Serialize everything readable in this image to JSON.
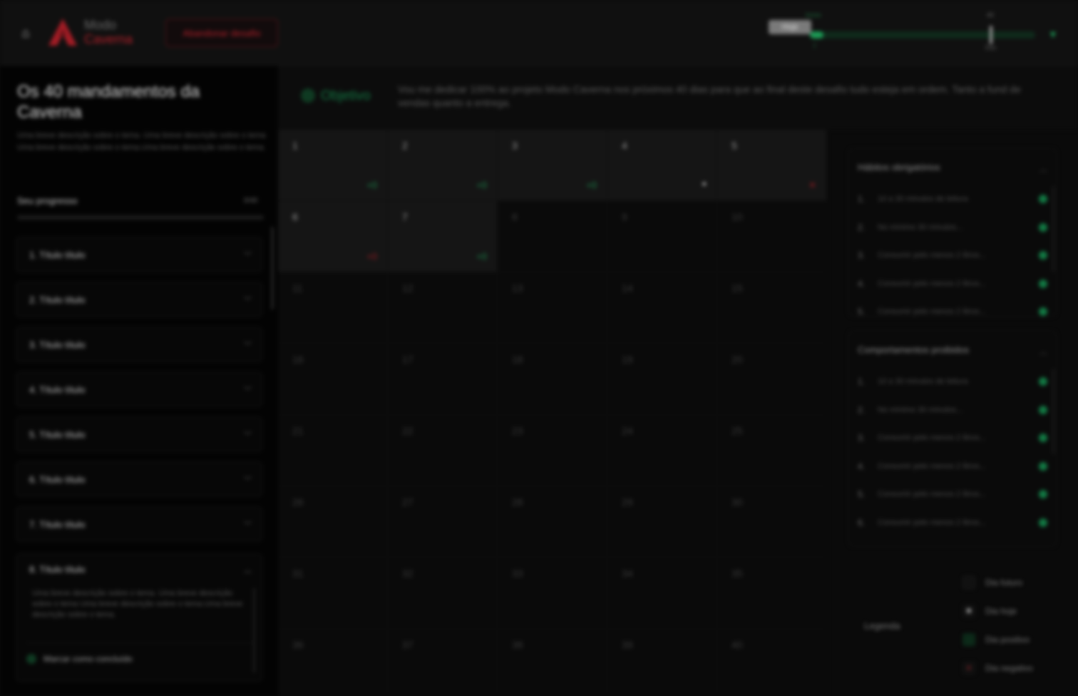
{
  "header": {
    "home_icon": "home-icon",
    "logo_line1": "Modo",
    "logo_line2": "Caverna",
    "abandon_label": "Abandonar desafio",
    "progress": {
      "day_tag": "Hoje",
      "label_top": "Início",
      "label_bottom": "7",
      "label_marker_top": "40",
      "label_marker_bottom": "Fim",
      "fill_fraction": 0.06,
      "marker_fraction": 0.8
    },
    "colors": {
      "accent_red": "#b3202a",
      "accent_green": "#1c9a55"
    }
  },
  "sidebar": {
    "title": "Os 40 mandamentos da Caverna",
    "description": "Uma breve descrição sobre o tema. Uma breve descrição sobre o tema Uma breve descrição sobre o tema.Uma breve descrição sobre o tema.",
    "progress_label": "Seu progresso",
    "progress_value": "0/40",
    "items": [
      {
        "label": "1. Título título"
      },
      {
        "label": "2. Título título"
      },
      {
        "label": "3. Título título"
      },
      {
        "label": "4. Título título"
      },
      {
        "label": "5. Título título"
      },
      {
        "label": "6. Título título"
      },
      {
        "label": "7. Título título"
      }
    ],
    "open_item": {
      "label": "8. Título título",
      "body": "Uma breve descrição sobre o tema. Uma breve descrição sobre o tema Uma breve descrição sobre o tema.Uma breve descrição sobre o tema.",
      "mark_label": "Marcar como concluído"
    }
  },
  "objective": {
    "label": "Objetivo",
    "text": "Vou me dedicar 100% ao projeto Modo Caverna nos próximos 40 dias para que ao final deste desafio tudo esteja em ordem. Tanto a fund de vendas quanto a entrega."
  },
  "calendar": {
    "days": [
      {
        "n": "1",
        "state": "pos",
        "mark": "+0"
      },
      {
        "n": "2",
        "state": "pos",
        "mark": "+0"
      },
      {
        "n": "3",
        "state": "pos",
        "mark": "+0"
      },
      {
        "n": "4",
        "state": "today",
        "mark": "●"
      },
      {
        "n": "5",
        "state": "neg",
        "mark": "✕"
      },
      {
        "n": "6",
        "state": "neg",
        "mark": "+0"
      },
      {
        "n": "7",
        "state": "pos",
        "mark": "+0"
      },
      {
        "n": "8",
        "state": "future",
        "mark": ""
      },
      {
        "n": "9",
        "state": "future",
        "mark": ""
      },
      {
        "n": "10",
        "state": "future",
        "mark": ""
      },
      {
        "n": "11",
        "state": "future",
        "mark": ""
      },
      {
        "n": "12",
        "state": "future",
        "mark": ""
      },
      {
        "n": "13",
        "state": "future",
        "mark": ""
      },
      {
        "n": "14",
        "state": "future",
        "mark": ""
      },
      {
        "n": "15",
        "state": "future",
        "mark": ""
      },
      {
        "n": "16",
        "state": "future",
        "mark": ""
      },
      {
        "n": "17",
        "state": "future",
        "mark": ""
      },
      {
        "n": "18",
        "state": "future",
        "mark": ""
      },
      {
        "n": "19",
        "state": "future",
        "mark": ""
      },
      {
        "n": "20",
        "state": "future",
        "mark": ""
      },
      {
        "n": "21",
        "state": "future",
        "mark": ""
      },
      {
        "n": "22",
        "state": "future",
        "mark": ""
      },
      {
        "n": "23",
        "state": "future",
        "mark": ""
      },
      {
        "n": "24",
        "state": "future",
        "mark": ""
      },
      {
        "n": "25",
        "state": "future",
        "mark": ""
      },
      {
        "n": "26",
        "state": "future",
        "mark": ""
      },
      {
        "n": "27",
        "state": "future",
        "mark": ""
      },
      {
        "n": "28",
        "state": "future",
        "mark": ""
      },
      {
        "n": "29",
        "state": "future",
        "mark": ""
      },
      {
        "n": "30",
        "state": "future",
        "mark": ""
      },
      {
        "n": "31",
        "state": "future",
        "mark": ""
      },
      {
        "n": "32",
        "state": "future",
        "mark": ""
      },
      {
        "n": "33",
        "state": "future",
        "mark": ""
      },
      {
        "n": "34",
        "state": "future",
        "mark": ""
      },
      {
        "n": "35",
        "state": "future",
        "mark": ""
      },
      {
        "n": "36",
        "state": "future",
        "mark": ""
      },
      {
        "n": "37",
        "state": "future",
        "mark": ""
      },
      {
        "n": "38",
        "state": "future",
        "mark": ""
      },
      {
        "n": "39",
        "state": "future",
        "mark": ""
      },
      {
        "n": "40",
        "state": "future",
        "mark": ""
      }
    ]
  },
  "panels": {
    "habits": {
      "title": "Hábitos obrigatórios",
      "items": [
        {
          "n": "1.",
          "text": "10 a 30 minutos de leitura"
        },
        {
          "n": "2.",
          "text": "No mínimo 30 minutos..."
        },
        {
          "n": "3.",
          "text": "Consumir pelo menos 2 litros..."
        },
        {
          "n": "4.",
          "text": "Consumir pelo menos 2 litros..."
        },
        {
          "n": "5.",
          "text": "Consumir pelo menos 2 litros..."
        }
      ]
    },
    "forbidden": {
      "title": "Comportamentos proibidos",
      "items": [
        {
          "n": "1.",
          "text": "10 a 30 minutos de leitura"
        },
        {
          "n": "2.",
          "text": "No mínimo 30 minutos..."
        },
        {
          "n": "3.",
          "text": "Consumir pelo menos 2 litros..."
        },
        {
          "n": "4.",
          "text": "Consumir pelo menos 2 litros..."
        },
        {
          "n": "5.",
          "text": "Consumir pelo menos 2 litros..."
        },
        {
          "n": "6.",
          "text": "Consumir pelo menos 2 litros..."
        },
        {
          "n": "7.",
          "text": "Consumir pelo menos 2 litros..."
        }
      ]
    }
  },
  "legend": {
    "label": "Legenda",
    "items": [
      {
        "text": "Dia futuro",
        "kind": "future"
      },
      {
        "text": "Dia hoje",
        "kind": "today"
      },
      {
        "text": "Dia positivo",
        "kind": "positive"
      },
      {
        "text": "Dia negativo",
        "kind": "negative"
      }
    ]
  }
}
